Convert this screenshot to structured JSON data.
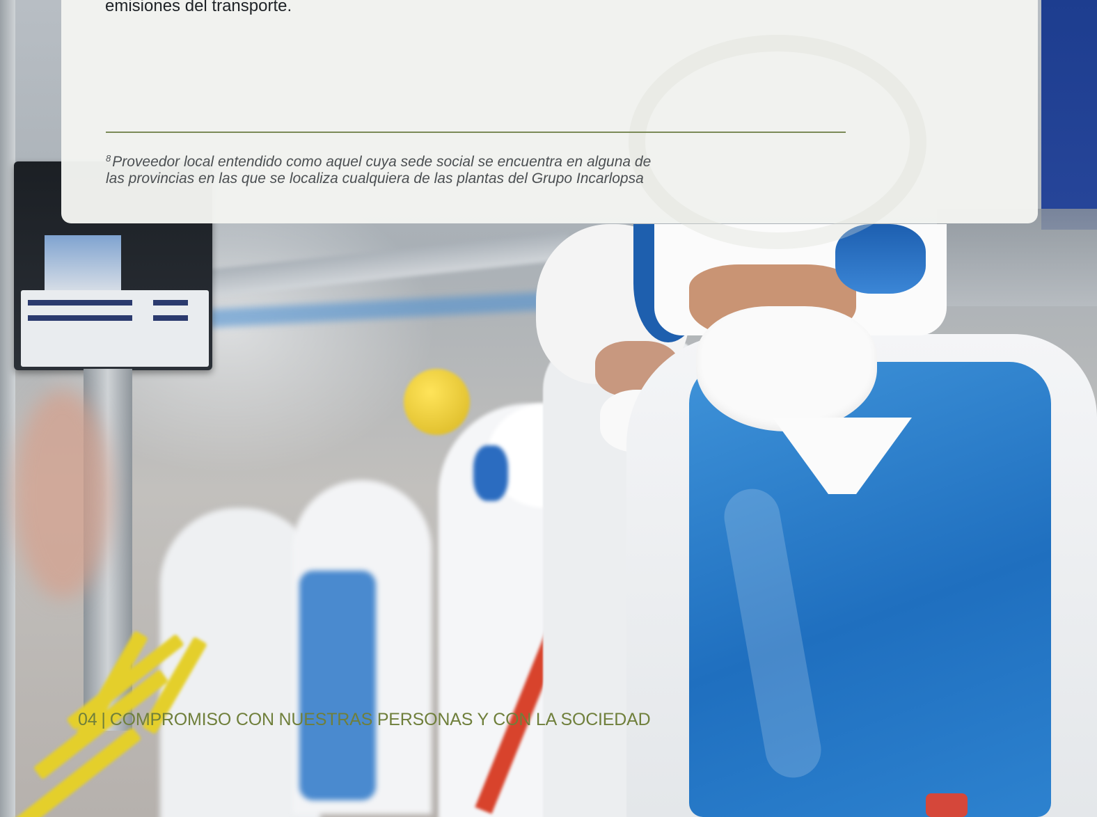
{
  "card": {
    "body_text_tail": "emisiones del transporte.",
    "footnote_marker": "8",
    "footnote_line1": "Proveedor local entendido como aquel cuya sede social se encuentra en alguna de",
    "footnote_line2": "las provincias en las que se localiza cualquiera de las plantas del Grupo Incarlopsa"
  },
  "footer": {
    "section_number": "04",
    "separator": "|",
    "section_title": "COMPROMISO CON NUESTRAS PERSONAS Y CON LA SOCIEDAD"
  },
  "colors": {
    "accent_green": "#6f7f3b",
    "rule_green": "#7b8a57",
    "card_background": "#f3f4f1",
    "apron_blue": "#2d82cf"
  }
}
